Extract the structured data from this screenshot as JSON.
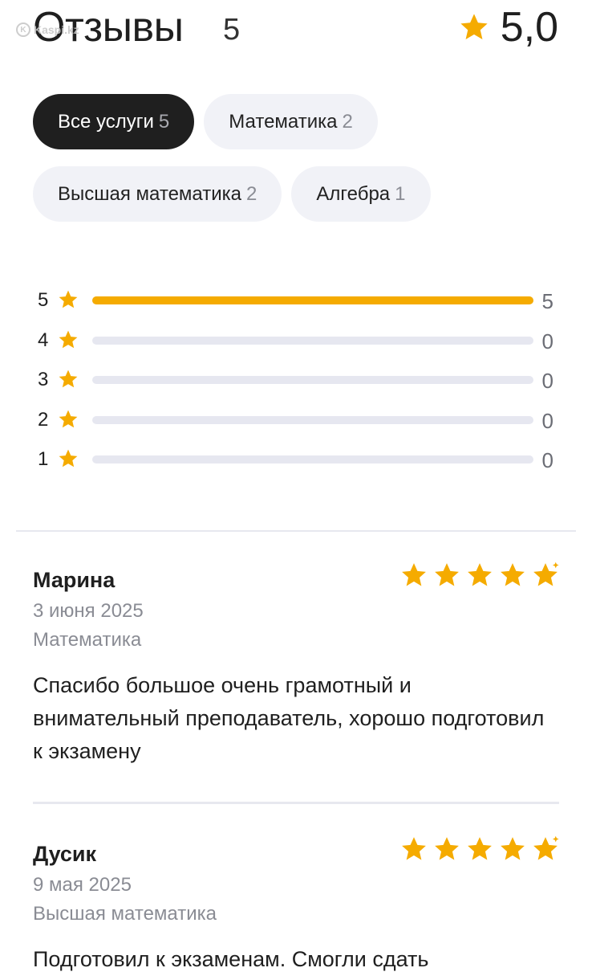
{
  "watermark": "Kaspi.kz",
  "header": {
    "title": "Отзывы",
    "count": "5",
    "rating": "5,0"
  },
  "filters": [
    {
      "label": "Все услуги",
      "count": "5",
      "active": true
    },
    {
      "label": "Математика",
      "count": "2",
      "active": false
    },
    {
      "label": "Высшая математика",
      "count": "2",
      "active": false
    },
    {
      "label": "Алгебра",
      "count": "1",
      "active": false
    }
  ],
  "distribution": [
    {
      "stars": "5",
      "count": "5",
      "fill": 1.0
    },
    {
      "stars": "4",
      "count": "0",
      "fill": 0
    },
    {
      "stars": "3",
      "count": "0",
      "fill": 0
    },
    {
      "stars": "2",
      "count": "0",
      "fill": 0
    },
    {
      "stars": "1",
      "count": "0",
      "fill": 0
    }
  ],
  "reviews": [
    {
      "name": "Марина",
      "date": "3 июня 2025",
      "service": "Математика",
      "rating": 5,
      "text": "Спасибо большое очень грамотный и внимательный преподаватель, хорошо подготовил к экзамену"
    },
    {
      "name": "Дусик",
      "date": "9 мая 2025",
      "service": "Высшая математика",
      "rating": 5,
      "text": "Подготовил к экзаменам. Смогли сдать"
    }
  ],
  "colors": {
    "accent": "#f5ab00",
    "chip_bg": "#f1f2f7",
    "chip_active_bg": "#1f1f1f",
    "muted": "#8a8c94"
  }
}
